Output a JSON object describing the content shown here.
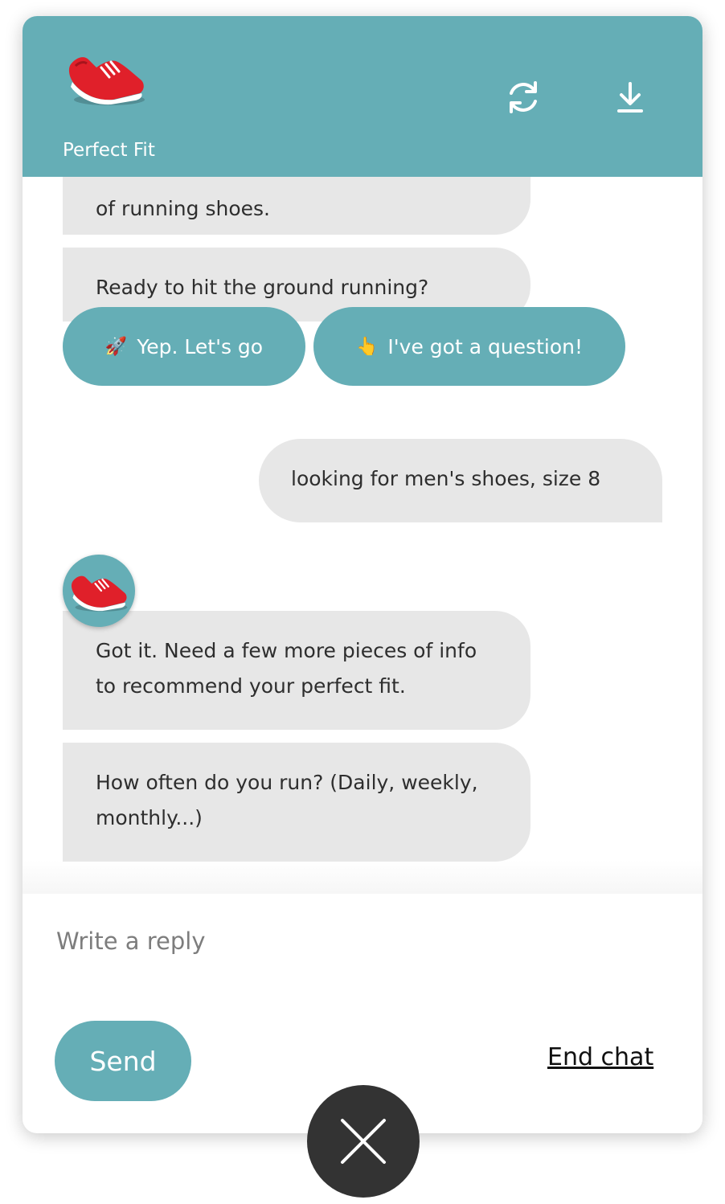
{
  "header": {
    "brand_name": "Perfect Fit",
    "logo_icon": "red-running-shoe-icon",
    "refresh_icon": "refresh-icon",
    "download_icon": "download-icon",
    "color": "#65aeb6"
  },
  "messages": {
    "bot_1_partial": "of running shoes.",
    "bot_2": "Ready to hit the ground running?",
    "quick_replies": [
      {
        "emoji": "🚀",
        "label": "Yep. Let's go"
      },
      {
        "emoji": "👆",
        "label": "I've got a question!"
      }
    ],
    "user_1": "looking for men's shoes, size 8",
    "bot_3": "Got it. Need a few more pieces of info to recommend your perfect fit.",
    "bot_4": "How often do you run? (Daily, weekly, monthly...)"
  },
  "composer": {
    "placeholder": "Write a reply",
    "send_label": "Send",
    "end_chat_label": "End chat"
  },
  "close_icon": "close-icon",
  "colors": {
    "accent": "#65aeb6",
    "bubble": "#e7e7e7",
    "close": "#333333"
  }
}
